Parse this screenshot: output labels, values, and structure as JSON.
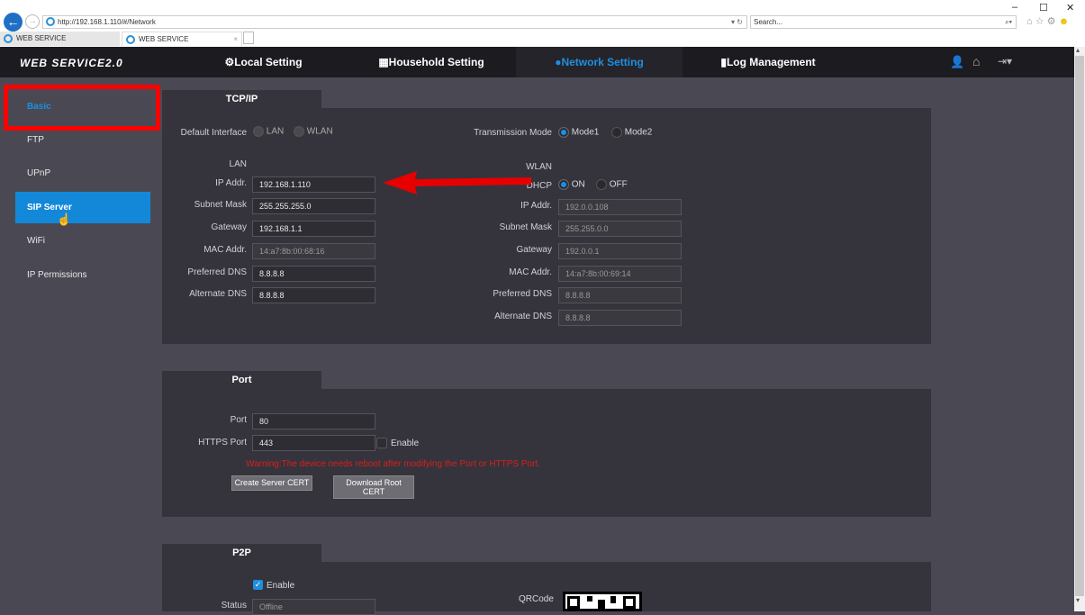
{
  "browser": {
    "url": "http://192.168.1.110/#/Network",
    "search_placeholder": "Search...",
    "tabs": [
      "WEB SERVICE",
      "WEB SERVICE"
    ]
  },
  "nav": {
    "logo": "WEB SERVICE2.0",
    "items": [
      "Local Setting",
      "Household Setting",
      "Network Setting",
      "Log Management"
    ]
  },
  "sidebar": {
    "items": [
      "Basic",
      "FTP",
      "UPnP",
      "SIP Server",
      "WiFi",
      "IP Permissions"
    ]
  },
  "tcpip": {
    "title": "TCP/IP",
    "default_interface_label": "Default Interface",
    "iface_options": [
      "LAN",
      "WLAN"
    ],
    "transmission_mode_label": "Transmission Mode",
    "mode_options": [
      "Mode1",
      "Mode2"
    ],
    "lan": {
      "heading": "LAN",
      "fields": [
        {
          "label": "IP Addr.",
          "value": "192.168.1.110"
        },
        {
          "label": "Subnet Mask",
          "value": "255.255.255.0"
        },
        {
          "label": "Gateway",
          "value": "192.168.1.1"
        },
        {
          "label": "MAC Addr.",
          "value": "14:a7:8b:00:68:16"
        },
        {
          "label": "Preferred DNS",
          "value": "8.8.8.8"
        },
        {
          "label": "Alternate DNS",
          "value": "8.8.8.8"
        }
      ]
    },
    "wlan": {
      "heading": "WLAN",
      "dhcp_label": "DHCP",
      "dhcp_options": [
        "ON",
        "OFF"
      ],
      "fields": [
        {
          "label": "IP Addr.",
          "value": "192.0.0.108"
        },
        {
          "label": "Subnet Mask",
          "value": "255.255.0.0"
        },
        {
          "label": "Gateway",
          "value": "192.0.0.1"
        },
        {
          "label": "MAC Addr.",
          "value": "14:a7:8b:00:69:14"
        },
        {
          "label": "Preferred DNS",
          "value": "8.8.8.8"
        },
        {
          "label": "Alternate DNS",
          "value": "8.8.8.8"
        }
      ]
    }
  },
  "port": {
    "title": "Port",
    "port_label": "Port",
    "port_value": "80",
    "https_label": "HTTPS Port",
    "https_value": "443",
    "enable_label": "Enable",
    "warning": "Warning:The device needs reboot after modifying the Port or HTTPS Port.",
    "create_cert": "Create Server CERT",
    "download_cert": "Download Root CERT"
  },
  "p2p": {
    "title": "P2P",
    "enable_label": "Enable",
    "status_label": "Status",
    "status_value": "Offline",
    "qrcode_label": "QRCode"
  }
}
